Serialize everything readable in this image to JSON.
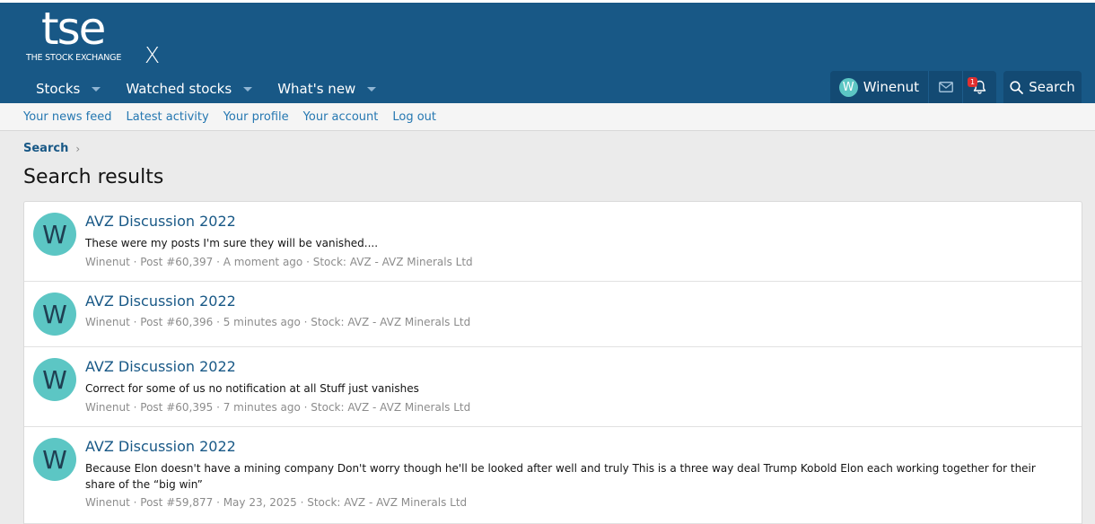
{
  "logo": {
    "main": "tse",
    "sub": "THE STOCK EXCHANGE",
    "x": "X"
  },
  "nav": {
    "tabs": [
      {
        "label": "Stocks"
      },
      {
        "label": "Watched stocks"
      },
      {
        "label": "What's new"
      }
    ]
  },
  "userbar": {
    "avatar_letter": "W",
    "username": "Winenut",
    "alerts_count": "1",
    "search_label": "Search"
  },
  "subnav": {
    "links": [
      "Your news feed",
      "Latest activity",
      "Your profile",
      "Your account",
      "Log out"
    ]
  },
  "breadcrumb": {
    "label": "Search",
    "chevron": "›"
  },
  "page_title": "Search results",
  "results": [
    {
      "avatar": "W",
      "title": "AVZ Discussion 2022",
      "snippet": "These were my posts I'm sure they will be vanished....",
      "meta": "Winenut · Post #60,397 · A moment ago · Stock: AVZ - AVZ Minerals Ltd"
    },
    {
      "avatar": "W",
      "title": "AVZ Discussion 2022",
      "snippet": "",
      "meta": "Winenut · Post #60,396 · 5 minutes ago · Stock: AVZ - AVZ Minerals Ltd"
    },
    {
      "avatar": "W",
      "title": "AVZ Discussion 2022",
      "snippet": "Correct for some of us no notification at all Stuff just vanishes",
      "meta": "Winenut · Post #60,395 · 7 minutes ago · Stock: AVZ - AVZ Minerals Ltd"
    },
    {
      "avatar": "W",
      "title": "AVZ Discussion 2022",
      "snippet": "Because Elon doesn't have a mining company Don't worry though he'll be looked after well and truly This is a three way deal Trump Kobold Elon each working together for their share of the “big win”",
      "meta": "Winenut · Post #59,877 · May 23, 2025 · Stock: AVZ - AVZ Minerals Ltd"
    }
  ],
  "colors": {
    "header": "#185886",
    "accent": "#2577b1",
    "avatar": "#5cc6c4",
    "badge": "#e03030"
  }
}
